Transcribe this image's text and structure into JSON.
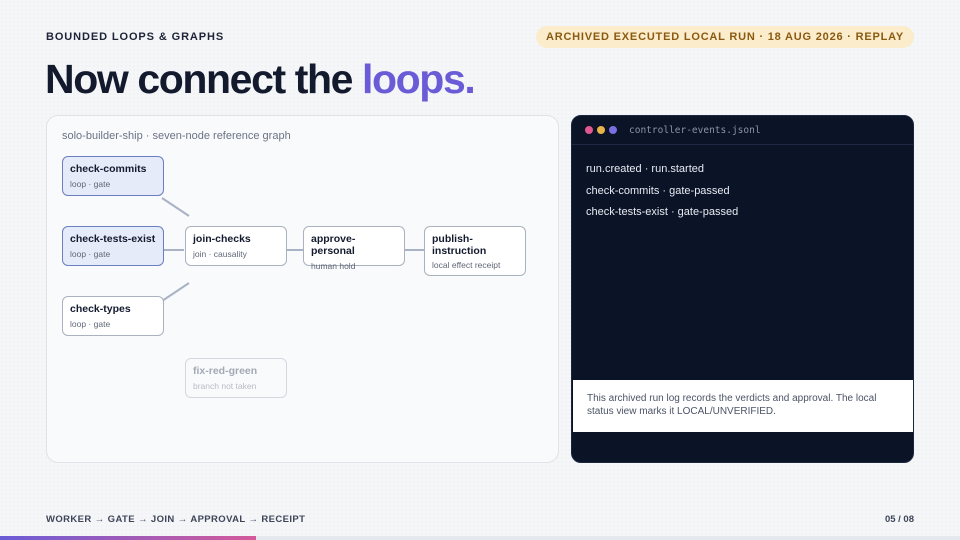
{
  "header": {
    "eyebrow": "BOUNDED LOOPS & GRAPHS",
    "badge": "ARCHIVED EXECUTED LOCAL RUN · 18 AUG 2026 · REPLAY",
    "title_prefix": "Now connect the ",
    "title_accent": "loops."
  },
  "graph": {
    "caption": "solo-builder-ship · seven-node reference graph",
    "nodes": {
      "check_commits": {
        "title": "check-commits",
        "sub": "loop · gate"
      },
      "check_tests_exist": {
        "title": "check-tests-exist",
        "sub": "loop · gate"
      },
      "check_types": {
        "title": "check-types",
        "sub": "loop · gate"
      },
      "join_checks": {
        "title": "join-checks",
        "sub": "join · causality"
      },
      "approve_personal": {
        "title": "approve-personal",
        "sub": "human hold"
      },
      "publish_instruction": {
        "title": "publish-instruction",
        "sub": "local effect receipt"
      },
      "fix_red_green": {
        "title": "fix-red-green",
        "sub": "branch not taken"
      }
    }
  },
  "terminal": {
    "filename": "controller-events.jsonl",
    "lines": [
      "run.created · run.started",
      "check-commits · gate-passed",
      "check-tests-exist · gate-passed"
    ],
    "note": "This archived run log records the verdicts and approval. The local status view marks it LOCAL/UNVERIFIED."
  },
  "footer": {
    "flow": "WORKER → GATE → JOIN → APPROVAL → RECEIPT",
    "page": "05 / 08",
    "progress": 0.267
  },
  "colors": {
    "accent": "#6a5cd6",
    "badge_bg": "#fbeccb",
    "badge_text": "#8a5a12",
    "terminal_bg": "#0b1327",
    "active_node": "#e6ebf9"
  }
}
